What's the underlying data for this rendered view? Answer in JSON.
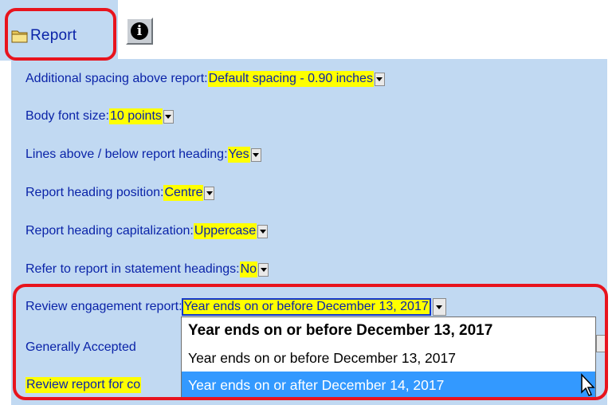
{
  "tabs": {
    "report_label": "Report",
    "info_icon": "info-icon",
    "folder_icon": "folder-icon"
  },
  "settings": [
    {
      "label": "Additional spacing above report: ",
      "value": "Default spacing - 0.90 inches"
    },
    {
      "label": "Body font size: ",
      "value": "10 points"
    },
    {
      "label": "Lines above / below report heading: ",
      "value": "Yes"
    },
    {
      "label": "Report heading position: ",
      "value": "Centre"
    },
    {
      "label": "Report heading capitalization: ",
      "value": "Uppercase"
    },
    {
      "label": "Refer to report in statement headings: ",
      "value": "No"
    },
    {
      "label": "Review engagement report: ",
      "value": "Year ends on or before December 13, 2017"
    },
    {
      "label": "Generally Accepted",
      "value": ""
    },
    {
      "label": "",
      "value": "Review report for co"
    }
  ],
  "dropdown_options": [
    "Year ends on or before December 13, 2017",
    "Year ends on or before December 13, 2017",
    "Year ends on or after December 14, 2017"
  ],
  "colors": {
    "panel_bg": "#c1d9f2",
    "label_text": "#0a23a8",
    "value_highlight": "#ffff00",
    "callout_border": "#e8141e",
    "selected_option": "#3399ff"
  }
}
